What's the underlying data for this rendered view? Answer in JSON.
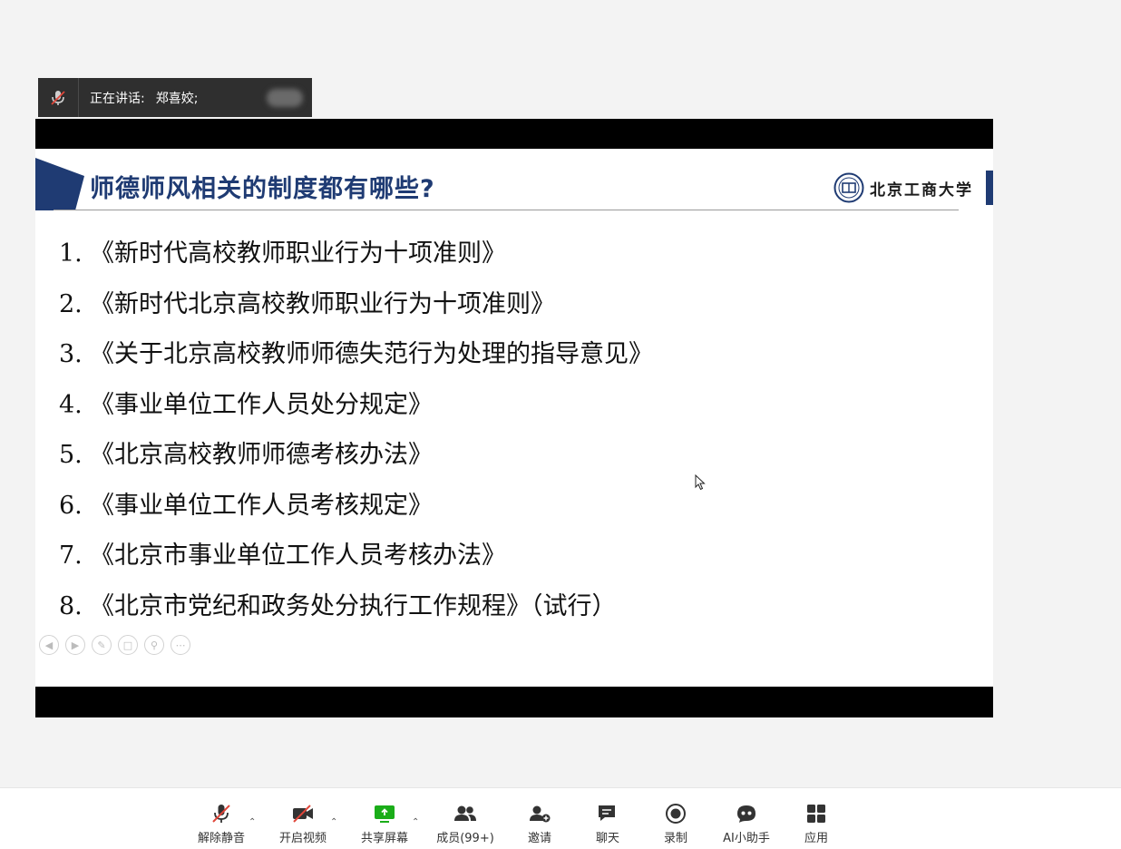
{
  "speaker": {
    "prefix": "正在讲话:",
    "name": "郑喜姣;"
  },
  "slide": {
    "title": "师德师风相关的制度都有哪些?",
    "university": "北京工商大学",
    "items": [
      {
        "num": "1.",
        "text": "《新时代高校教师职业行为十项准则》"
      },
      {
        "num": "2.",
        "text": "《新时代北京高校教师职业行为十项准则》"
      },
      {
        "num": "3.",
        "text": "《关于北京高校教师师德失范行为处理的指导意见》"
      },
      {
        "num": "4.",
        "text": "《事业单位工作人员处分规定》"
      },
      {
        "num": "5.",
        "text": "《北京高校教师师德考核办法》"
      },
      {
        "num": "6.",
        "text": "《事业单位工作人员考核规定》"
      },
      {
        "num": "7.",
        "text": "《北京市事业单位工作人员考核办法》"
      },
      {
        "num": "8.",
        "text": "《北京市党纪和政务处分执行工作规程》（试行）"
      }
    ],
    "controls": [
      "prev-icon",
      "next-icon",
      "pen-icon",
      "slides-icon",
      "zoom-icon",
      "more-icon"
    ]
  },
  "toolbar": {
    "unmute": "解除静音",
    "video": "开启视频",
    "share": "共享屏幕",
    "members": "成员(99+)",
    "invite": "邀请",
    "chat": "聊天",
    "record": "录制",
    "ai": "AI小助手",
    "apps": "应用"
  },
  "colors": {
    "accent_green": "#1aad19",
    "slide_blue": "#1f3b73",
    "mute_red": "#e0463a"
  }
}
